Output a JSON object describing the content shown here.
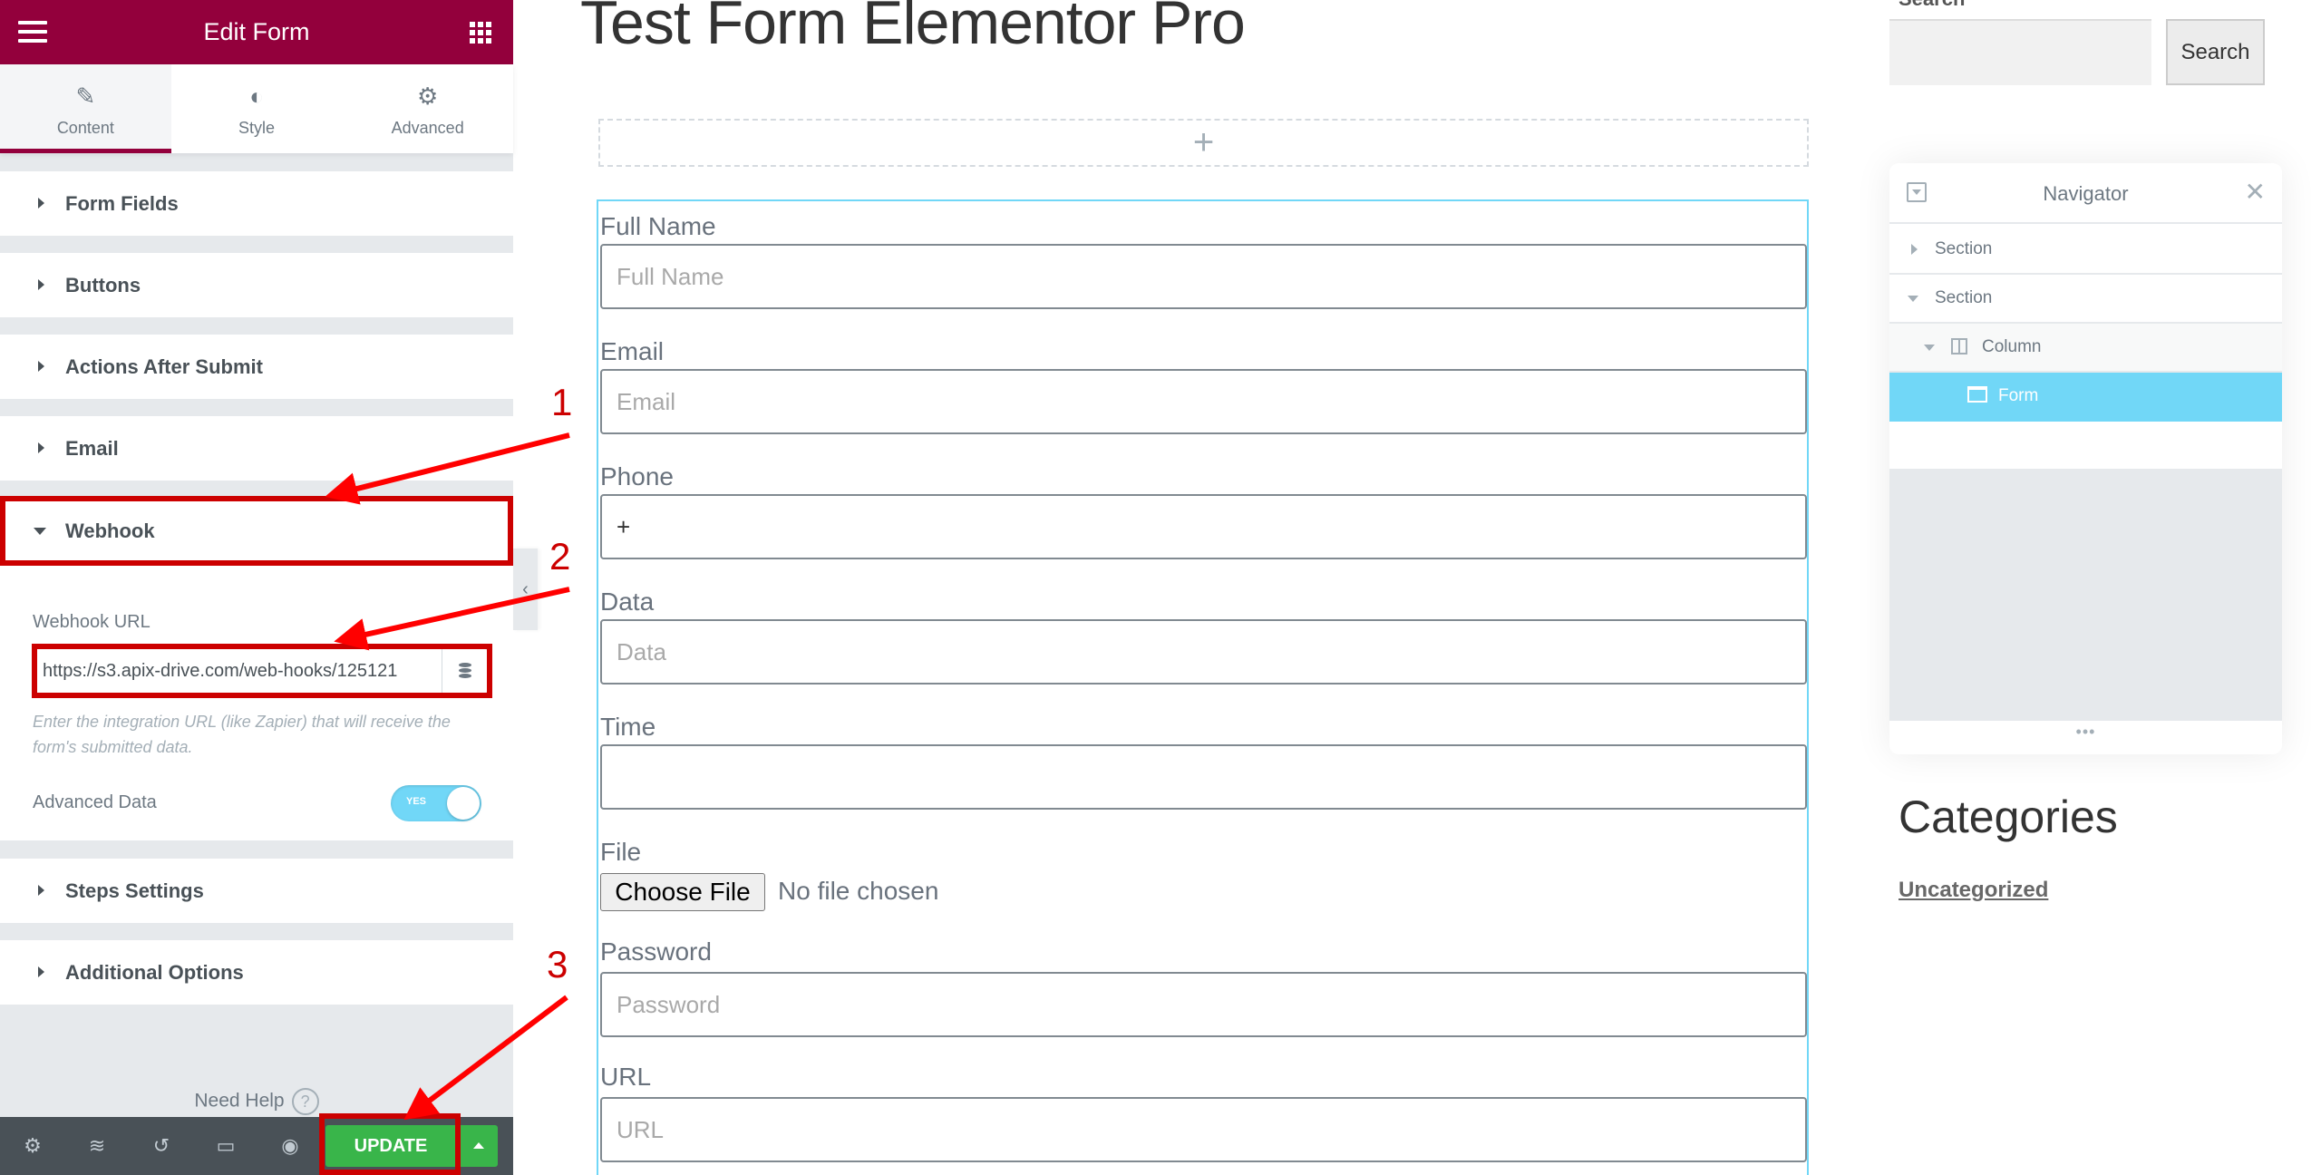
{
  "sidebar": {
    "header": {
      "title": "Edit Form",
      "menu_icon": "hamburger-icon",
      "apps_icon": "grid-icon"
    },
    "tabs": [
      {
        "label": "Content",
        "icon": "pencil-icon",
        "active": true
      },
      {
        "label": "Style",
        "icon": "half-circle-icon",
        "active": false
      },
      {
        "label": "Advanced",
        "icon": "gear-icon",
        "active": false
      }
    ],
    "sections": [
      {
        "label": "Form Fields",
        "expanded": false
      },
      {
        "label": "Buttons",
        "expanded": false
      },
      {
        "label": "Actions After Submit",
        "expanded": false
      },
      {
        "label": "Email",
        "expanded": false
      },
      {
        "label": "Webhook",
        "expanded": true
      },
      {
        "label": "Steps Settings",
        "expanded": false
      },
      {
        "label": "Additional Options",
        "expanded": false
      }
    ],
    "webhook": {
      "url_label": "Webhook URL",
      "url_value": "https://s3.apix-drive.com/web-hooks/125121",
      "description": "Enter the integration URL (like Zapier) that will receive the form's submitted data.",
      "advanced_data_label": "Advanced Data",
      "advanced_data_toggle": "YES",
      "advanced_data_on": true
    },
    "need_help": "Need Help",
    "help_icon": "?",
    "footer": {
      "icons": [
        "settings-icon",
        "navigator-layers-icon",
        "history-icon",
        "responsive-mode-icon",
        "preview-eye-icon"
      ],
      "update_label": "UPDATE"
    },
    "collapse_handle": "‹"
  },
  "main": {
    "page_title": "Test Form Elementor Pro",
    "add_section_icon": "+",
    "form": {
      "fields": [
        {
          "label": "Full Name",
          "placeholder": "Full Name",
          "value": ""
        },
        {
          "label": "Email",
          "placeholder": "Email",
          "value": ""
        },
        {
          "label": "Phone",
          "placeholder": "",
          "value": "+"
        },
        {
          "label": "Data",
          "placeholder": "Data",
          "value": ""
        },
        {
          "label": "Time",
          "placeholder": "",
          "value": ""
        },
        {
          "label": "File",
          "type": "file",
          "button": "Choose File",
          "status": "No file chosen"
        },
        {
          "label": "Password",
          "placeholder": "Password",
          "value": ""
        },
        {
          "label": "URL",
          "placeholder": "URL",
          "value": ""
        }
      ]
    }
  },
  "right": {
    "search_label": "Search",
    "search_button": "Search",
    "search_value": "",
    "navigator": {
      "title": "Navigator",
      "close": "✕",
      "items": [
        {
          "label": "Section",
          "expanded": false,
          "level": 0
        },
        {
          "label": "Section",
          "expanded": true,
          "level": 0
        },
        {
          "label": "Column",
          "expanded": true,
          "level": 1
        },
        {
          "label": "Form",
          "selected": true,
          "level": 2
        }
      ],
      "resize_handle": "•••"
    },
    "categories_title": "Categories",
    "categories": [
      "Uncategorized"
    ]
  },
  "annotations": {
    "step1": "1",
    "step2": "2",
    "step3": "3",
    "color": "#cc0000"
  },
  "colors": {
    "brand": "#93003c",
    "accent": "#71d7f7",
    "update_green": "#39b54a"
  }
}
